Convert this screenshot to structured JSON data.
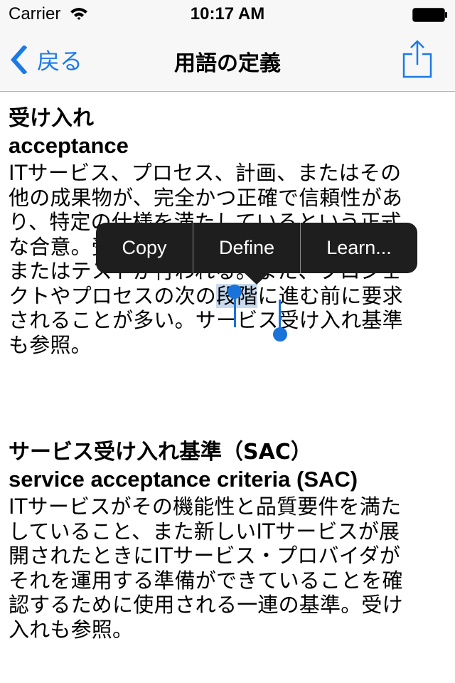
{
  "status_bar": {
    "carrier": "Carrier",
    "time": "10:17 AM",
    "wifi_icon": "wifi-icon",
    "battery_icon": "battery-full-icon"
  },
  "nav_bar": {
    "back_label": "戻る",
    "back_icon": "chevron-left-icon",
    "title": "用語の定義",
    "share_icon": "share-icon"
  },
  "colors": {
    "accent": "#1a7ae6",
    "selection_highlight": "#c8daee",
    "selection_handle": "#1a73d9",
    "menu_background": "#1e1e1e",
    "chrome_background": "#f7f7f7"
  },
  "entries": [
    {
      "term_ja": "受け入れ",
      "term_en": "acceptance",
      "definition_lines": [
        "ITサービス、プロセス、計画、またはその",
        "他の成果物が、完全かつ正確で信頼性があ",
        "り、特定の仕様を満たしているという正式",
        "な合意。受け入れの前には通常、評価",
        "またはテストが行われる。また、プロジェ",
        "クトやプロセスの次の",
        "に進む前に要求",
        "されることが多い。サービス受け入れ基準",
        "も参照。"
      ],
      "selected_text": "段階"
    },
    {
      "term_ja": "サービス受け入れ基準（SAC）",
      "term_en": "service acceptance criteria (SAC)",
      "definition_lines": [
        "ITサービスがその機能性と品質要件を満た",
        "していること、また新しいITサービスが展",
        "開されたときにITサービス・プロバイダが",
        "それを運用する準備ができていることを確",
        "認するために使用される一連の基準。受け",
        "入れも参照。"
      ]
    }
  ],
  "edit_menu": {
    "items": [
      {
        "label": "Copy"
      },
      {
        "label": "Define"
      },
      {
        "label": "Learn..."
      }
    ]
  }
}
